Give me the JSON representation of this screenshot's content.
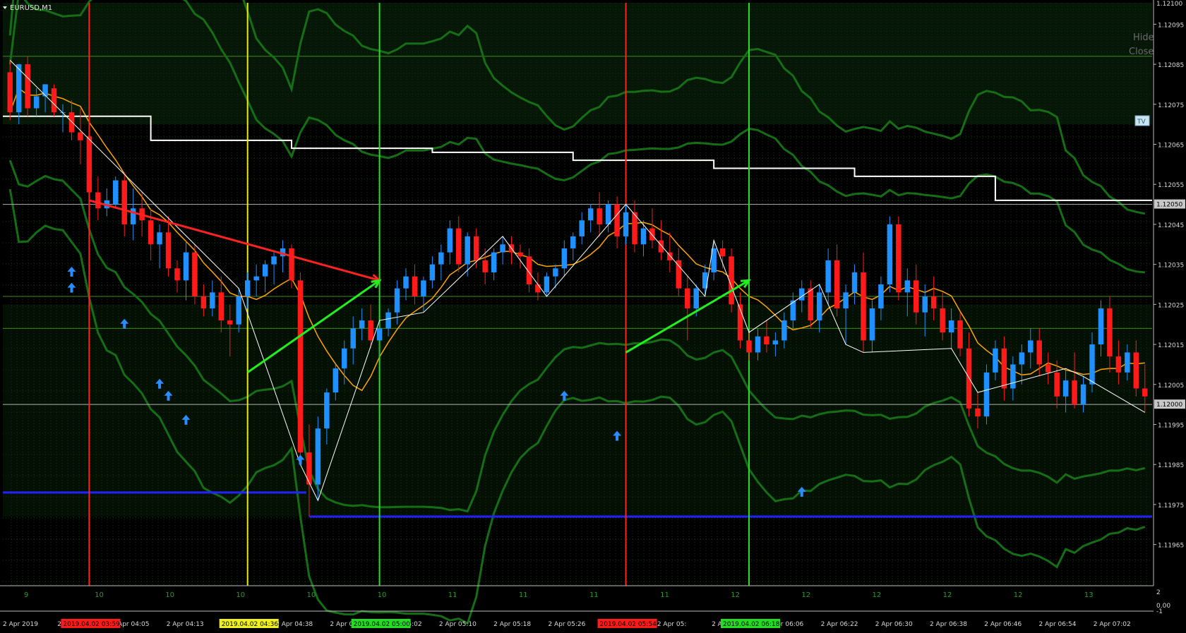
{
  "window": {
    "symbol_title": "EURUSD,M1"
  },
  "overlay_buttons": {
    "hide": "Hide",
    "close": "Close",
    "tv": "TV"
  },
  "colors": {
    "background": "#000000",
    "bull": "#1e90ff",
    "bear": "#ff1a1a",
    "bollinger": "#156e15",
    "ma": "#ffa500",
    "zigzag": "#ffffff",
    "trend_up": "#22ee22",
    "trend_down": "#ff2222",
    "support": "#2222ff",
    "vline_red": "#ff2020",
    "vline_green": "#22dd22",
    "vline_yellow": "#e8e820",
    "arrows": "#2a8cff"
  },
  "chart_data": {
    "type": "candlestick",
    "symbol": "EURUSD",
    "timeframe": "M1",
    "ylim": [
      1.1196,
      1.121
    ],
    "y_ticks": [
      "1.12095",
      "1.12085",
      "1.12075",
      "1.12065",
      "1.12055",
      "1.12045",
      "1.12035",
      "1.12025",
      "1.12015",
      "1.12005",
      "1.11995",
      "1.11985",
      "1.11975",
      "1.11965"
    ],
    "y_top_label": "1.12100",
    "y_marked": [
      {
        "label": "1.12050",
        "value": 1.1205
      },
      {
        "label": "1.12000",
        "value": 1.12
      }
    ],
    "x_ticks": [
      "2 Apr 2019",
      "2 Apr 03:",
      "2 Apr 04:05",
      "2 Apr 04:13",
      "2 Apr 04:21",
      "2 Apr 04:38",
      "2 Apr 04:46",
      "2 Apr 05:02",
      "2 Apr 05:10",
      "2 Apr 05:18",
      "2 Apr 05:26",
      "2 Apr 05:34",
      "2 Apr 05:",
      "2 Apr 05:58",
      "2 Apr 06:06",
      "2 Apr 06:22",
      "2 Apr 06:30",
      "2 Apr 06:38",
      "2 Apr 06:46",
      "2 Apr 06:54",
      "2 Apr 07:02"
    ],
    "x_badges": [
      {
        "text": "2019.04.02 03:59",
        "color": "#ff1a1a",
        "text_color": "#000000"
      },
      {
        "text": "2019.04.02 04:36",
        "color": "#f0f020",
        "text_color": "#000000"
      },
      {
        "text": "2019.04.02 05:00",
        "color": "#22dd22",
        "text_color": "#000000"
      },
      {
        "text": "2019.04.02 05:54",
        "color": "#ff1a1a",
        "text_color": "#000000"
      },
      {
        "text": "2019.04.02 06:18",
        "color": "#22dd22",
        "text_color": "#000000"
      }
    ],
    "hour_labels": [
      "9",
      "10",
      "10",
      "10",
      "10",
      "10",
      "11",
      "11",
      "11",
      "11",
      "12",
      "12",
      "12",
      "12",
      "12",
      "13"
    ],
    "subwindow_scale": [
      "2",
      "0.00",
      "-1"
    ],
    "support_level": 1.11972,
    "support_level_left": 1.11978,
    "resistance_segments": [
      1.12072,
      1.12066,
      1.12064,
      1.12063,
      1.12061,
      1.12059,
      1.12057,
      1.12051
    ],
    "candles": [
      [
        1.12083,
        1.12086,
        1.12071,
        1.12073
      ],
      [
        1.12073,
        1.12085,
        1.1207,
        1.12085
      ],
      [
        1.12085,
        1.12087,
        1.12072,
        1.12074
      ],
      [
        1.12074,
        1.12079,
        1.12072,
        1.12077
      ],
      [
        1.12077,
        1.1208,
        1.12073,
        1.1208
      ],
      [
        1.12079,
        1.1208,
        1.12072,
        1.12073
      ],
      [
        1.12073,
        1.12075,
        1.12068,
        1.12073
      ],
      [
        1.12073,
        1.12076,
        1.12066,
        1.12068
      ],
      [
        1.12068,
        1.12074,
        1.1206,
        1.12066
      ],
      [
        1.12067,
        1.12074,
        1.12052,
        1.12053
      ],
      [
        1.12053,
        1.12057,
        1.12046,
        1.12049
      ],
      [
        1.12049,
        1.12054,
        1.12047,
        1.12051
      ],
      [
        1.1205,
        1.12057,
        1.12049,
        1.12056
      ],
      [
        1.12056,
        1.12058,
        1.12042,
        1.12045
      ],
      [
        1.12045,
        1.12054,
        1.12041,
        1.12049
      ],
      [
        1.12049,
        1.12053,
        1.12042,
        1.12046
      ],
      [
        1.12046,
        1.12049,
        1.12036,
        1.1204
      ],
      [
        1.1204,
        1.12045,
        1.12034,
        1.12043
      ],
      [
        1.12043,
        1.12047,
        1.12032,
        1.12034
      ],
      [
        1.12034,
        1.12036,
        1.12028,
        1.12031
      ],
      [
        1.12031,
        1.12041,
        1.12026,
        1.12038
      ],
      [
        1.12038,
        1.1204,
        1.12025,
        1.12027
      ],
      [
        1.12027,
        1.1203,
        1.12022,
        1.12024
      ],
      [
        1.12024,
        1.12031,
        1.12022,
        1.12028
      ],
      [
        1.12028,
        1.12032,
        1.12018,
        1.12021
      ],
      [
        1.12021,
        1.12025,
        1.12012,
        1.1202
      ],
      [
        1.1202,
        1.12029,
        1.12018,
        1.12027
      ],
      [
        1.12027,
        1.12033,
        1.12024,
        1.12031
      ],
      [
        1.12031,
        1.12035,
        1.12027,
        1.12032
      ],
      [
        1.12032,
        1.12036,
        1.12028,
        1.12035
      ],
      [
        1.12035,
        1.12038,
        1.1203,
        1.12037
      ],
      [
        1.12037,
        1.12041,
        1.12033,
        1.12039
      ],
      [
        1.12039,
        1.1204,
        1.12029,
        1.12031
      ],
      [
        1.12031,
        1.12033,
        1.11985,
        1.11988
      ],
      [
        1.11988,
        1.11995,
        1.11972,
        1.1198
      ],
      [
        1.1198,
        1.11997,
        1.11976,
        1.11994
      ],
      [
        1.11994,
        1.12004,
        1.1199,
        1.12003
      ],
      [
        1.12003,
        1.1201,
        1.12001,
        1.12009
      ],
      [
        1.12009,
        1.12016,
        1.12005,
        1.12014
      ],
      [
        1.12014,
        1.12022,
        1.1201,
        1.12019
      ],
      [
        1.12019,
        1.12024,
        1.12016,
        1.12021
      ],
      [
        1.12021,
        1.12025,
        1.12014,
        1.12016
      ],
      [
        1.12016,
        1.12021,
        1.12012,
        1.12019
      ],
      [
        1.12019,
        1.12024,
        1.12017,
        1.12023
      ],
      [
        1.12023,
        1.12031,
        1.1202,
        1.12029
      ],
      [
        1.12029,
        1.12034,
        1.12026,
        1.12032
      ],
      [
        1.12032,
        1.12035,
        1.12025,
        1.12027
      ],
      [
        1.12027,
        1.12032,
        1.12023,
        1.12031
      ],
      [
        1.12031,
        1.12037,
        1.12029,
        1.12035
      ],
      [
        1.12035,
        1.1204,
        1.12031,
        1.12038
      ],
      [
        1.12038,
        1.12046,
        1.12035,
        1.12044
      ],
      [
        1.12044,
        1.12047,
        1.12033,
        1.12035
      ],
      [
        1.12035,
        1.12043,
        1.12032,
        1.12042
      ],
      [
        1.12042,
        1.12044,
        1.12034,
        1.12036
      ],
      [
        1.12036,
        1.12039,
        1.1203,
        1.12033
      ],
      [
        1.12033,
        1.12039,
        1.12031,
        1.12038
      ],
      [
        1.12038,
        1.12042,
        1.12035,
        1.1204
      ],
      [
        1.1204,
        1.12042,
        1.12035,
        1.12038
      ],
      [
        1.12038,
        1.1204,
        1.12034,
        1.12037
      ],
      [
        1.12037,
        1.12039,
        1.12028,
        1.1203
      ],
      [
        1.1203,
        1.12033,
        1.12026,
        1.12028
      ],
      [
        1.12028,
        1.12033,
        1.12027,
        1.12032
      ],
      [
        1.12032,
        1.12035,
        1.12029,
        1.12034
      ],
      [
        1.12034,
        1.12041,
        1.12032,
        1.12039
      ],
      [
        1.12039,
        1.12043,
        1.12036,
        1.12042
      ],
      [
        1.12042,
        1.12048,
        1.1204,
        1.12046
      ],
      [
        1.12046,
        1.1205,
        1.12043,
        1.12049
      ],
      [
        1.12049,
        1.12053,
        1.12042,
        1.12045
      ],
      [
        1.12045,
        1.12051,
        1.12043,
        1.1205
      ],
      [
        1.1205,
        1.12052,
        1.12039,
        1.12042
      ],
      [
        1.12042,
        1.1205,
        1.1204,
        1.12048
      ],
      [
        1.12048,
        1.12051,
        1.12038,
        1.1204
      ],
      [
        1.1204,
        1.12046,
        1.12037,
        1.12044
      ],
      [
        1.12044,
        1.12049,
        1.12039,
        1.12041
      ],
      [
        1.12041,
        1.12046,
        1.12036,
        1.12038
      ],
      [
        1.12038,
        1.12043,
        1.12033,
        1.12036
      ],
      [
        1.12036,
        1.12039,
        1.12027,
        1.12029
      ],
      [
        1.12029,
        1.12032,
        1.12016,
        1.12024
      ],
      [
        1.12024,
        1.1203,
        1.12022,
        1.12029
      ],
      [
        1.12029,
        1.12035,
        1.12027,
        1.12033
      ],
      [
        1.12033,
        1.12041,
        1.12031,
        1.12039
      ],
      [
        1.12039,
        1.12041,
        1.12034,
        1.12037
      ],
      [
        1.12037,
        1.12039,
        1.12023,
        1.12025
      ],
      [
        1.12025,
        1.12028,
        1.12014,
        1.12016
      ],
      [
        1.12016,
        1.12018,
        1.12011,
        1.12013
      ],
      [
        1.12013,
        1.12019,
        1.12011,
        1.12017
      ],
      [
        1.12017,
        1.12021,
        1.12013,
        1.12015
      ],
      [
        1.12015,
        1.12018,
        1.12012,
        1.12016
      ],
      [
        1.12016,
        1.12023,
        1.12014,
        1.12021
      ],
      [
        1.12021,
        1.12028,
        1.12019,
        1.12026
      ],
      [
        1.12026,
        1.12031,
        1.12023,
        1.12029
      ],
      [
        1.12029,
        1.12031,
        1.12019,
        1.12021
      ],
      [
        1.12021,
        1.1203,
        1.12018,
        1.12028
      ],
      [
        1.12028,
        1.12039,
        1.12025,
        1.12036
      ],
      [
        1.12036,
        1.1204,
        1.12022,
        1.12024
      ],
      [
        1.12024,
        1.1203,
        1.12015,
        1.12028
      ],
      [
        1.12028,
        1.12035,
        1.12025,
        1.12033
      ],
      [
        1.12033,
        1.12038,
        1.12013,
        1.12016
      ],
      [
        1.12016,
        1.12026,
        1.12013,
        1.12024
      ],
      [
        1.12024,
        1.12032,
        1.12021,
        1.1203
      ],
      [
        1.1203,
        1.12047,
        1.12028,
        1.12045
      ],
      [
        1.12045,
        1.12047,
        1.12026,
        1.12028
      ],
      [
        1.12028,
        1.12034,
        1.12022,
        1.12031
      ],
      [
        1.12031,
        1.12035,
        1.1202,
        1.12023
      ],
      [
        1.12023,
        1.1203,
        1.12017,
        1.12027
      ],
      [
        1.12027,
        1.12032,
        1.12021,
        1.12024
      ],
      [
        1.12024,
        1.12028,
        1.12016,
        1.12018
      ],
      [
        1.12018,
        1.12024,
        1.12014,
        1.12021
      ],
      [
        1.12021,
        1.12023,
        1.12012,
        1.12014
      ],
      [
        1.12014,
        1.12018,
        1.11997,
        1.11999
      ],
      [
        1.11999,
        1.12003,
        1.11994,
        1.11997
      ],
      [
        1.11997,
        1.1201,
        1.11995,
        1.12008
      ],
      [
        1.12008,
        1.12016,
        1.12006,
        1.12014
      ],
      [
        1.12014,
        1.12017,
        1.12001,
        1.12004
      ],
      [
        1.12004,
        1.12012,
        1.12001,
        1.1201
      ],
      [
        1.1201,
        1.12015,
        1.12005,
        1.12013
      ],
      [
        1.12013,
        1.12019,
        1.12009,
        1.12016
      ],
      [
        1.12016,
        1.12019,
        1.12007,
        1.1201
      ],
      [
        1.1201,
        1.12013,
        1.12005,
        1.12008
      ],
      [
        1.12008,
        1.12011,
        1.11999,
        1.12002
      ],
      [
        1.12002,
        1.12009,
        1.11998,
        1.12006
      ],
      [
        1.12006,
        1.12013,
        1.11999,
        1.12
      ],
      [
        1.12,
        1.12007,
        1.11998,
        1.12005
      ],
      [
        1.12005,
        1.12018,
        1.12003,
        1.12015
      ],
      [
        1.12015,
        1.12026,
        1.12012,
        1.12024
      ],
      [
        1.12024,
        1.12027,
        1.12008,
        1.12012
      ],
      [
        1.12012,
        1.12016,
        1.12005,
        1.12008
      ],
      [
        1.12008,
        1.12015,
        1.12006,
        1.12013
      ],
      [
        1.12013,
        1.12016,
        1.12002,
        1.12004
      ],
      [
        1.12004,
        1.1201,
        1.11998,
        1.12002
      ]
    ]
  }
}
